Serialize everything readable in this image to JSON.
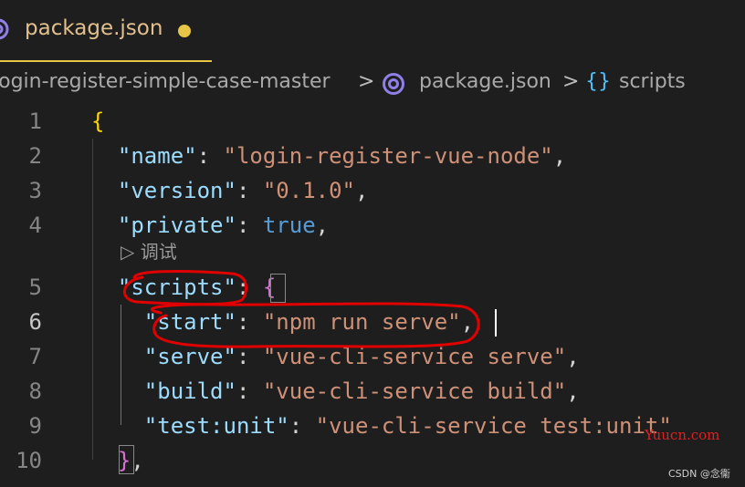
{
  "tab": {
    "label": "package.json",
    "icon": "package-json-icon",
    "dirty": true
  },
  "breadcrumb": {
    "folder": "login-register-simple-case-master",
    "file": "package.json",
    "symbol": "scripts",
    "separator": ">",
    "braces": "{}"
  },
  "codelens": {
    "label": "▷ 调试"
  },
  "editor": {
    "active_line": 6,
    "lines": [
      {
        "number": "1",
        "indent": "",
        "tokens": [
          {
            "t": "{",
            "c": "b1"
          }
        ]
      },
      {
        "number": "2",
        "indent": "  ",
        "tokens": [
          {
            "t": "\"name\"",
            "c": "k"
          },
          {
            "t": ": ",
            "c": "p"
          },
          {
            "t": "\"login-register-vue-node\"",
            "c": "s"
          },
          {
            "t": ",",
            "c": "p"
          }
        ]
      },
      {
        "number": "3",
        "indent": "  ",
        "tokens": [
          {
            "t": "\"version\"",
            "c": "k"
          },
          {
            "t": ": ",
            "c": "p"
          },
          {
            "t": "\"0.1.0\"",
            "c": "s"
          },
          {
            "t": ",",
            "c": "p"
          }
        ]
      },
      {
        "number": "4",
        "indent": "  ",
        "tokens": [
          {
            "t": "\"private\"",
            "c": "k"
          },
          {
            "t": ": ",
            "c": "p"
          },
          {
            "t": "true",
            "c": "kw"
          },
          {
            "t": ",",
            "c": "p"
          }
        ]
      },
      {
        "number": "5",
        "indent": "  ",
        "tokens": [
          {
            "t": "\"scripts\"",
            "c": "k"
          },
          {
            "t": ": ",
            "c": "p"
          },
          {
            "t": "{",
            "c": "b2"
          }
        ]
      },
      {
        "number": "6",
        "indent": "    ",
        "tokens": [
          {
            "t": "\"start\"",
            "c": "k"
          },
          {
            "t": ": ",
            "c": "p"
          },
          {
            "t": "\"npm run serve\"",
            "c": "s"
          },
          {
            "t": ",",
            "c": "p"
          }
        ]
      },
      {
        "number": "7",
        "indent": "    ",
        "tokens": [
          {
            "t": "\"serve\"",
            "c": "k"
          },
          {
            "t": ": ",
            "c": "p"
          },
          {
            "t": "\"vue-cli-service serve\"",
            "c": "s"
          },
          {
            "t": ",",
            "c": "p"
          }
        ]
      },
      {
        "number": "8",
        "indent": "    ",
        "tokens": [
          {
            "t": "\"build\"",
            "c": "k"
          },
          {
            "t": ": ",
            "c": "p"
          },
          {
            "t": "\"vue-cli-service build\"",
            "c": "s"
          },
          {
            "t": ",",
            "c": "p"
          }
        ]
      },
      {
        "number": "9",
        "indent": "    ",
        "tokens": [
          {
            "t": "\"test:unit\"",
            "c": "k"
          },
          {
            "t": ": ",
            "c": "p"
          },
          {
            "t": "\"vue-cli-service test:unit\"",
            "c": "s"
          }
        ]
      },
      {
        "number": "10",
        "indent": "  ",
        "tokens": [
          {
            "t": "}",
            "c": "b2"
          },
          {
            "t": ",",
            "c": "p"
          }
        ]
      }
    ]
  },
  "watermark": {
    "site": "Yuucn.com",
    "credit": "CSDN @念衞"
  },
  "colors": {
    "background": "#1e1e1e",
    "key": "#9cdcfe",
    "string": "#ce9178",
    "keyword": "#569cd6",
    "bracket_level1": "#ffd700",
    "bracket_level2": "#da70d6",
    "modified_tab": "#e2c08d",
    "annotation_ink": "#e00000"
  }
}
